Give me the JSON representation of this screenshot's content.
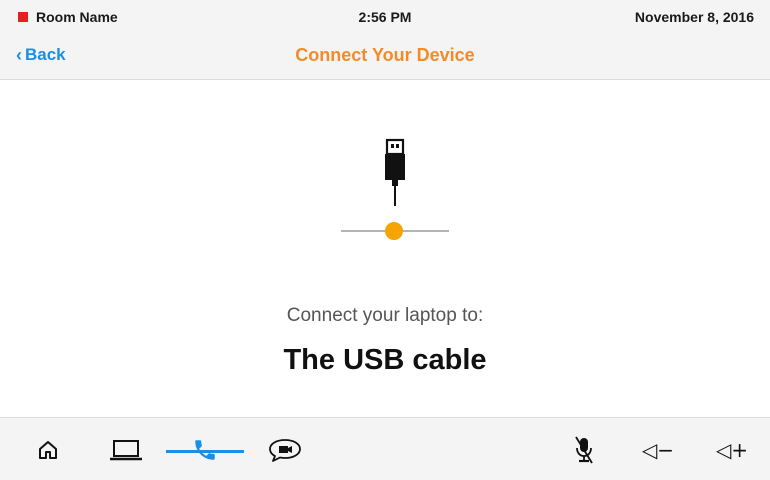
{
  "status_bar": {
    "room_name": "Room Name",
    "room_status_color": "#e62020",
    "time": "2:56 PM",
    "date": "November 8, 2016"
  },
  "nav_bar": {
    "back_label": "Back",
    "back_icon": "chevron-left-icon",
    "title": "Connect Your Device"
  },
  "content": {
    "graphic_icon": "usb-connector-icon",
    "prompt": "Connect your laptop to:",
    "source_name": "The USB cable"
  },
  "toolbar": {
    "left_buttons": [
      {
        "icon": "home-icon"
      },
      {
        "icon": "laptop-icon"
      },
      {
        "icon": "phone-icon",
        "active": true
      },
      {
        "icon": "video-chat-icon"
      }
    ],
    "right_buttons": [
      {
        "icon": "microphone-muted-icon"
      },
      {
        "icon": "volume-down-icon",
        "label": "◁−"
      },
      {
        "icon": "volume-up-icon",
        "label": "◁+"
      }
    ]
  },
  "colors": {
    "accent_blue": "#1a8fe3",
    "accent_orange": "#f28c28",
    "indicator_orange": "#f7a300",
    "bar_background": "#f4f4f4"
  }
}
